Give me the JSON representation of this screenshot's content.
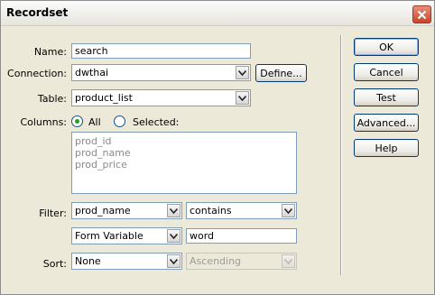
{
  "window": {
    "title": "Recordset"
  },
  "form": {
    "name_label": "Name:",
    "name_value": "search",
    "connection_label": "Connection:",
    "connection_value": "dwthai",
    "define_button": "Define...",
    "table_label": "Table:",
    "table_value": "product_list",
    "columns_label": "Columns:",
    "columns_all": "All",
    "columns_selected": "Selected:",
    "columns_selected_mode": "All",
    "columns_list": [
      "prod_id",
      "prod_name",
      "prod_price"
    ],
    "filter_label": "Filter:",
    "filter_column": "prod_name",
    "filter_operator": "contains",
    "filter_source": "Form Variable",
    "filter_value": "word",
    "sort_label": "Sort:",
    "sort_column": "None",
    "sort_order": "Ascending"
  },
  "buttons": {
    "ok": "OK",
    "cancel": "Cancel",
    "test": "Test",
    "advanced": "Advanced...",
    "help": "Help"
  }
}
